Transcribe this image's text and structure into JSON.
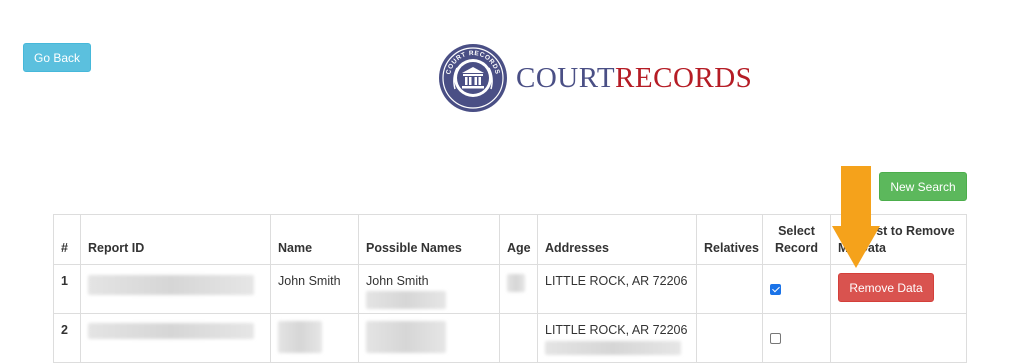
{
  "header": {
    "go_back_label": "Go Back",
    "logo_court": "COURT",
    "logo_records": "RECORDS",
    "logo_seal_text": "COURT RECORDS"
  },
  "actions": {
    "new_search_label": "New Search"
  },
  "colors": {
    "go_back": "#5bc0de",
    "new_search": "#5cb85c",
    "remove_data": "#d9534f",
    "arrow": "#f5a21b",
    "logo_blue": "#4a4f85",
    "logo_red": "#b51c25"
  },
  "table": {
    "headers": {
      "num": "#",
      "report_id": "Report ID",
      "name": "Name",
      "possible_names": "Possible Names",
      "age": "Age",
      "addresses": "Addresses",
      "relatives": "Relatives",
      "select_record": "Select Record",
      "request_remove": "Request to Remove My Data"
    },
    "rows": [
      {
        "num": "1",
        "name": "John Smith",
        "possible_names": "John Smith",
        "address": "LITTLE ROCK, AR 72206",
        "selected": true,
        "remove_label": "Remove Data"
      },
      {
        "num": "2",
        "name": "",
        "possible_names": "",
        "address": "LITTLE ROCK, AR 72206",
        "selected": false
      }
    ]
  }
}
